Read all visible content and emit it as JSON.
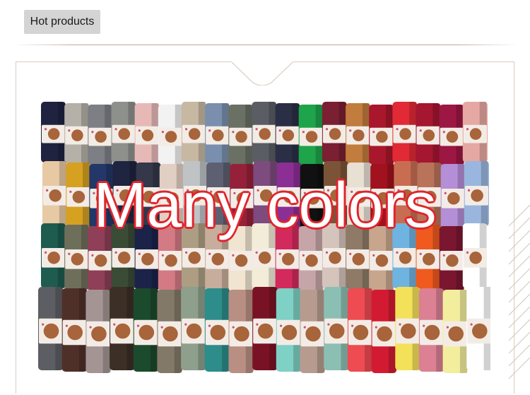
{
  "header": {
    "label": "Hot products"
  },
  "banner": {
    "caption": "Many colors"
  },
  "product_image": {
    "icon": "folded-scarves-photo",
    "rows": [
      [
        "#1f2340",
        "#b5b1a8",
        "#7d7f85",
        "#8e908c",
        "#e6b9b7",
        "#f2f2f2",
        "#c7b8a2",
        "#7a8fae",
        "#6a7064",
        "#5a5d64",
        "#2a2f45",
        "#1ea44a",
        "#7b1f33",
        "#c17c3e",
        "#a8172b",
        "#e12a36",
        "#a51630",
        "#9c1743",
        "#e6a8a2"
      ],
      [
        "#e7c9a4",
        "#d6a021",
        "#233768",
        "#1f2440",
        "#34384a",
        "#e2cfc3",
        "#bfc3c6",
        "#5d6070",
        "#95203a",
        "#7d4b7d",
        "#8c2f95",
        "#111111",
        "#7b5437",
        "#e8e0d3",
        "#a0121d",
        "#c86d52",
        "#b9735a",
        "#b48ed6",
        "#9ab6de"
      ],
      [
        "#1d5c4f",
        "#6e6f5b",
        "#8f3f57",
        "#3a4b36",
        "#1b2349",
        "#d47a84",
        "#ad9e83",
        "#c6ad9c",
        "#f1e4d0",
        "#f2ecd8",
        "#d22a5c",
        "#c6a5a8",
        "#d5c4bc",
        "#8e7a67",
        "#c8a68e",
        "#6fb3e1",
        "#f05a1e",
        "#7a1630",
        "#ffffff"
      ],
      [
        "#5c5e63",
        "#4f3029",
        "#a49594",
        "#3c2f26",
        "#1b4a2c",
        "#837968",
        "#8e9f8c",
        "#2d8d8a",
        "#b98f83",
        "#7a1225",
        "#7ed1c4",
        "#b79b8f",
        "#8bbfb3",
        "#ee4b52",
        "#d21b32",
        "#f4e15a",
        "#dc8093",
        "#f3ee9e",
        "#ffffff"
      ]
    ]
  },
  "colors": {
    "caption_outline": "#e0242c",
    "badge_bg": "#d4d4d4",
    "frame_border": "#d9cdbf"
  }
}
